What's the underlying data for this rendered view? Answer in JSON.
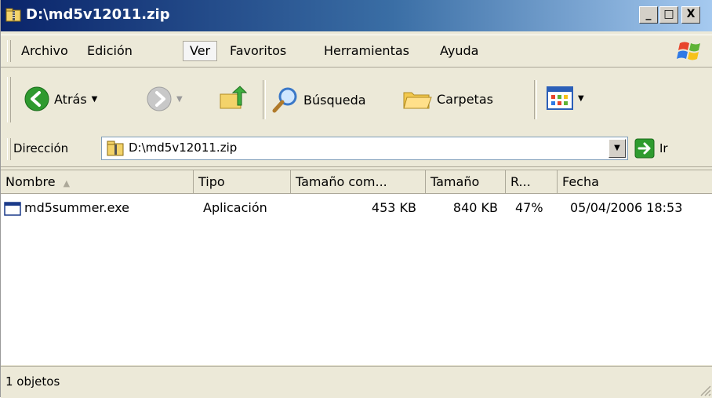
{
  "window": {
    "title": "D:\\md5v12011.zip",
    "controls": {
      "minimize": "_",
      "maximize": "□",
      "close": "X"
    }
  },
  "menubar": {
    "items": [
      "Archivo",
      "Edición",
      "Ver",
      "Favoritos",
      "Herramientas",
      "Ayuda"
    ],
    "active": "Ver"
  },
  "toolbar": {
    "back_label": "Atrás",
    "search_label": "Búsqueda",
    "folders_label": "Carpetas"
  },
  "addressbar": {
    "label": "Dirección",
    "value": "D:\\md5v12011.zip",
    "go_label": "Ir"
  },
  "listview": {
    "columns": [
      "Nombre",
      "Tipo",
      "Tamaño com...",
      "Tamaño",
      "R...",
      "Fecha"
    ],
    "sort_column": "Nombre",
    "rows": [
      {
        "name": "md5summer.exe",
        "type": "Aplicación",
        "compressed_size": "453 KB",
        "size": "840 KB",
        "ratio": "47%",
        "date": "05/04/2006 18:53"
      }
    ]
  },
  "statusbar": {
    "text": "1 objetos"
  },
  "colors": {
    "title_start": "#0a246a",
    "title_end": "#a6caf0",
    "chrome": "#ece9d8",
    "back_green": "#2f9a2f",
    "go_green": "#2e9b2e"
  }
}
